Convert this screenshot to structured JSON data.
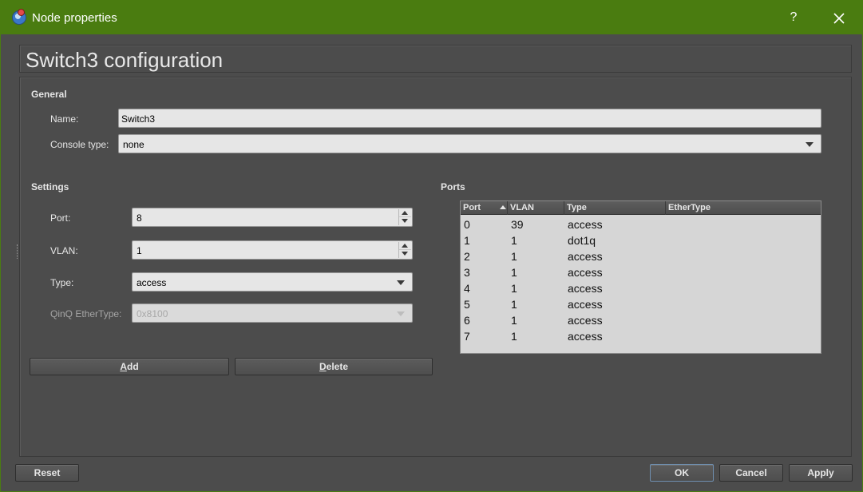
{
  "window": {
    "title": "Node properties",
    "help_label": "?",
    "close_label": "×"
  },
  "heading": "Switch3 configuration",
  "general": {
    "title": "General",
    "name_label": "Name:",
    "name_value": "Switch3",
    "console_type_label": "Console type:",
    "console_type_value": "none"
  },
  "settings": {
    "title": "Settings",
    "port_label": "Port:",
    "port_value": "8",
    "vlan_label": "VLAN:",
    "vlan_value": "1",
    "type_label": "Type:",
    "type_value": "access",
    "qinq_label": "QinQ EtherType:",
    "qinq_value": "0x8100",
    "add_label_underlined": "A",
    "add_label_rest": "dd",
    "delete_label_underlined": "D",
    "delete_label_rest": "elete"
  },
  "ports": {
    "title": "Ports",
    "columns": [
      "Port",
      "VLAN",
      "Type",
      "EtherType"
    ],
    "sorted_column": "Port",
    "sort_order": "ascending",
    "rows": [
      {
        "port": "0",
        "vlan": "39",
        "type": "access",
        "ethertype": ""
      },
      {
        "port": "1",
        "vlan": "1",
        "type": "dot1q",
        "ethertype": ""
      },
      {
        "port": "2",
        "vlan": "1",
        "type": "access",
        "ethertype": ""
      },
      {
        "port": "3",
        "vlan": "1",
        "type": "access",
        "ethertype": ""
      },
      {
        "port": "4",
        "vlan": "1",
        "type": "access",
        "ethertype": ""
      },
      {
        "port": "5",
        "vlan": "1",
        "type": "access",
        "ethertype": ""
      },
      {
        "port": "6",
        "vlan": "1",
        "type": "access",
        "ethertype": ""
      },
      {
        "port": "7",
        "vlan": "1",
        "type": "access",
        "ethertype": ""
      }
    ]
  },
  "footer": {
    "reset_label": "Reset",
    "ok_label": "OK",
    "cancel_label": "Cancel",
    "apply_label": "Apply"
  },
  "colors": {
    "titlebar": "#4a7c10",
    "background": "#4c4c4c",
    "table_background": "#d6d6d6"
  }
}
